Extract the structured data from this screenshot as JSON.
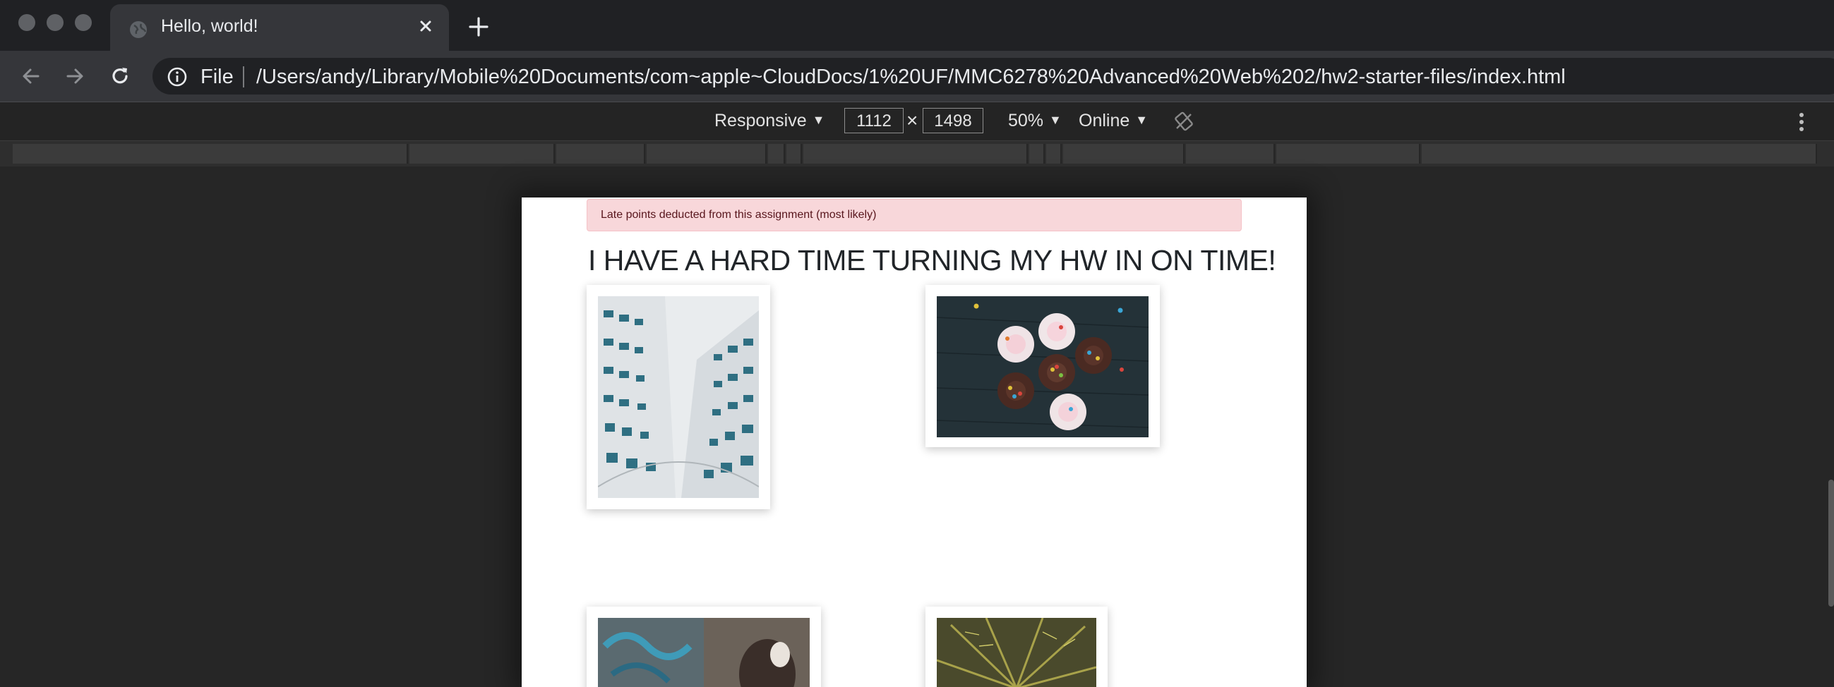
{
  "browser": {
    "tab": {
      "title": "Hello, world!",
      "favicon": "globe-icon"
    },
    "toolbar": {
      "scheme": "File",
      "url": "/Users/andy/Library/Mobile%20Documents/com~apple~CloudDocs/1%20UF/MMC6278%20Advanced%20Web%202/hw2-starter-files/index.html"
    }
  },
  "device_toolbar": {
    "device": "Responsive",
    "width": "1112",
    "times": "×",
    "height": "1498",
    "zoom": "50%",
    "network": "Online",
    "caret": "▼"
  },
  "page": {
    "alert": "Late points deducted from this assignment (most likely)",
    "heading": "I HAVE A HARD TIME TURNING MY HW IN ON TIME!",
    "images": [
      {
        "name": "building-photo"
      },
      {
        "name": "cupcakes-photo"
      },
      {
        "name": "graffiti-photo"
      },
      {
        "name": "palm-tree-photo"
      }
    ]
  },
  "colors": {
    "tabstrip": "#202124",
    "toolbar": "#35363a",
    "alert_bg": "#f8d7da",
    "alert_text": "#58151c"
  }
}
